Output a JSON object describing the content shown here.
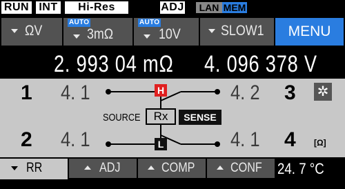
{
  "status": {
    "run": "RUN",
    "int": "INT",
    "hires": "Hi-Res",
    "adj": "ADJ",
    "lan": "LAN",
    "mem": "MEM"
  },
  "controls": {
    "function": "ΩV",
    "range_auto": "AUTO",
    "range": "3mΩ",
    "voltage_auto": "AUTO",
    "voltage": "10V",
    "speed": "SLOW1",
    "menu": "MENU"
  },
  "readout": {
    "resistance": "2. 993 04 mΩ",
    "voltage": "4. 096 378 V"
  },
  "diagram": {
    "terminals": [
      {
        "number": "1",
        "value": "4. 1"
      },
      {
        "number": "2",
        "value": "4. 1"
      },
      {
        "number": "3",
        "value": "4. 2"
      },
      {
        "number": "4",
        "value": "4. 1"
      }
    ],
    "high": "H",
    "low": "L",
    "source": "SOURCE",
    "rx": "Rx",
    "sense": "SENSE",
    "unit": "[Ω]",
    "settings_icon": "gear-icon"
  },
  "tabs": {
    "rr": "RR",
    "adj": "ADJ",
    "comp": "COMP",
    "conf": "CONF"
  },
  "temperature": "24. 7 °C",
  "colors": {
    "accent": "#2a7de0",
    "high": "#e02020",
    "panel": "#525252",
    "diagram_bg": "#c8c8c8"
  }
}
